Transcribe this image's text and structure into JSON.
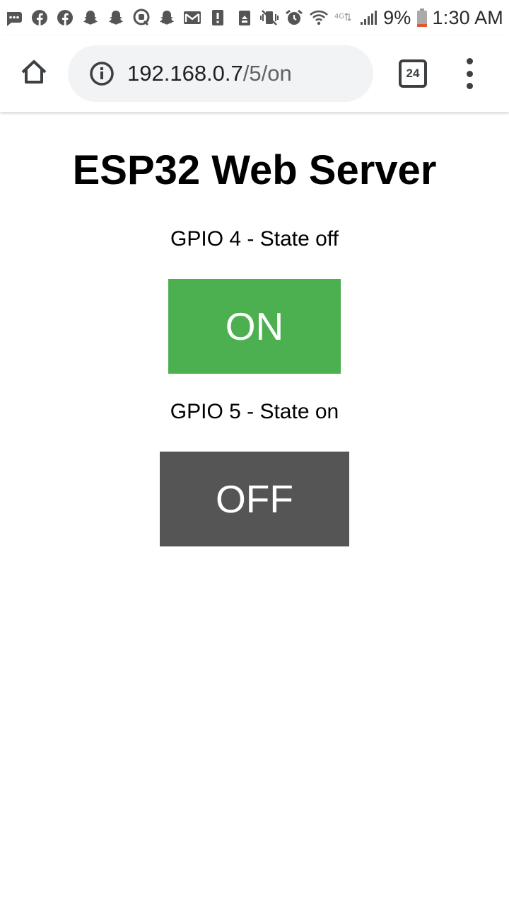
{
  "status_bar": {
    "battery_percent": "9%",
    "time": "1:30 AM",
    "left_icons": [
      "messages-icon",
      "facebook-icon",
      "facebook-icon",
      "snapchat-icon",
      "snapchat-icon",
      "quora-icon",
      "snapchat-icon",
      "gmail-icon",
      "alert-icon"
    ],
    "right_icons": [
      "recycle-icon",
      "vibrate-mute-icon",
      "alarm-icon",
      "wifi-icon",
      "lte-icon",
      "signal-icon",
      "battery-icon"
    ],
    "battery_color": "#e4572e"
  },
  "browser": {
    "url_host": "192.168.0.7",
    "url_path": "/5/on",
    "tab_count": "24"
  },
  "page": {
    "title": "ESP32 Web Server",
    "gpio4_label": "GPIO 4 - State off",
    "gpio4_button": "ON",
    "gpio5_label": "GPIO 5 - State on",
    "gpio5_button": "OFF"
  },
  "colors": {
    "on_button": "#4caf50",
    "off_button": "#555555"
  }
}
